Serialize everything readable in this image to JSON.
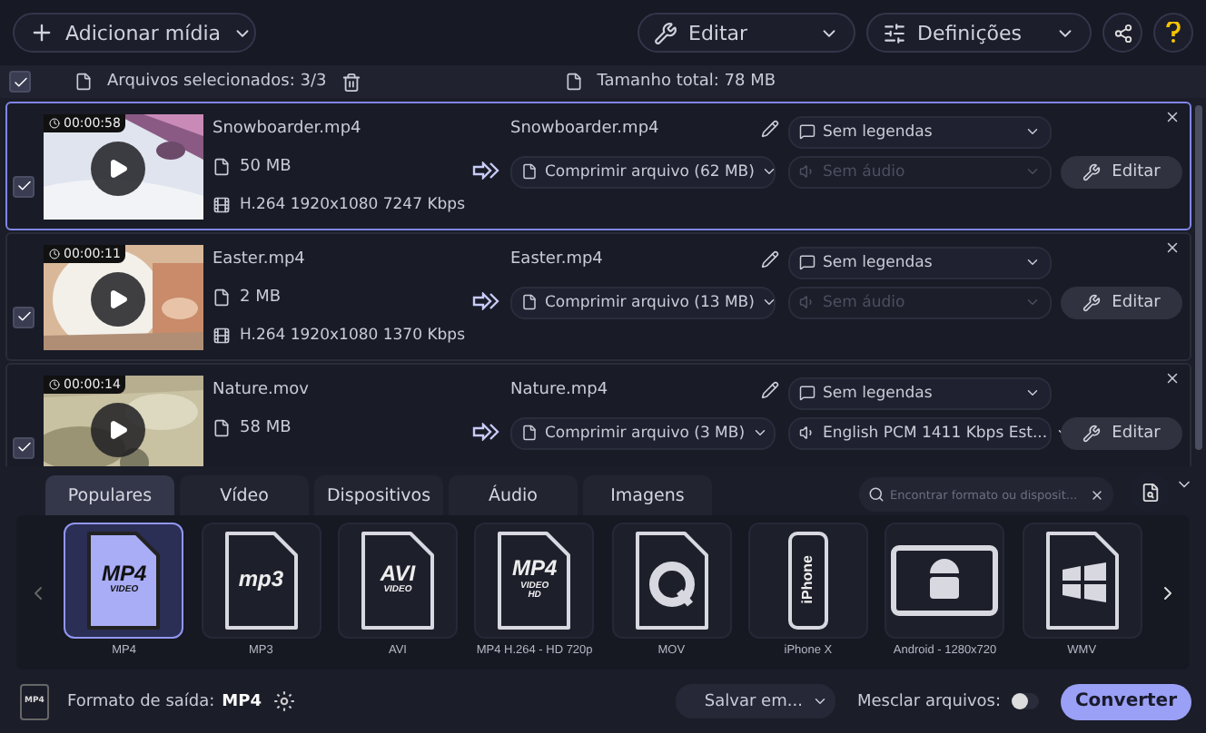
{
  "toolbar": {
    "add_button": "Adicionar mídia",
    "edit_menu": "Editar",
    "settings_menu": "Definições"
  },
  "selection": {
    "checked": true,
    "label": "Arquivos selecionados: 3/3",
    "total": "Tamanho total: 78 MB"
  },
  "files": [
    {
      "selected": true,
      "checked": true,
      "duration": "00:00:58",
      "name": "Snowboarder.mp4",
      "size": "50 MB",
      "codec": "H.264 1920x1080 7247 Kbps",
      "output_name": "Snowboarder.mp4",
      "compression": "Comprimir arquivo (62 MB)",
      "subtitles": "Sem legendas",
      "audio": "Sem áudio",
      "audio_disabled": true,
      "edit_button": "Editar"
    },
    {
      "selected": false,
      "checked": true,
      "duration": "00:00:11",
      "name": "Easter.mp4",
      "size": "2 MB",
      "codec": "H.264 1920x1080 1370 Kbps",
      "output_name": "Easter.mp4",
      "compression": "Comprimir arquivo (13 MB)",
      "subtitles": "Sem legendas",
      "audio": "Sem áudio",
      "audio_disabled": true,
      "edit_button": "Editar"
    },
    {
      "selected": false,
      "checked": true,
      "duration": "00:00:14",
      "name": "Nature.mov",
      "size": "58 MB",
      "output_name": "Nature.mp4",
      "compression": "Comprimir arquivo (3 MB)",
      "subtitles": "Sem legendas",
      "audio": "English PCM 1411 Kbps Est...",
      "audio_disabled": false,
      "edit_button": "Editar"
    }
  ],
  "format_tabs": [
    {
      "label": "Populares",
      "selected": true
    },
    {
      "label": "Vídeo",
      "selected": false
    },
    {
      "label": "Dispositivos",
      "selected": false
    },
    {
      "label": "Áudio",
      "selected": false
    },
    {
      "label": "Imagens",
      "selected": false
    }
  ],
  "search": {
    "placeholder": "Encontrar formato ou disposit..."
  },
  "formats": [
    {
      "label": "MP4",
      "selected": true,
      "kind": "doc",
      "icon_text": [
        "MP4",
        "VIDEO"
      ]
    },
    {
      "label": "MP3",
      "selected": false,
      "kind": "doc",
      "icon_text": [
        "mp3"
      ]
    },
    {
      "label": "AVI",
      "selected": false,
      "kind": "doc",
      "icon_text": [
        "AVI",
        "VIDEO"
      ]
    },
    {
      "label": "MP4 H.264 - HD 720p",
      "selected": false,
      "kind": "doc",
      "icon_text": [
        "MP4",
        "VIDEO",
        "HD"
      ]
    },
    {
      "label": "MOV",
      "selected": false,
      "kind": "quicktime"
    },
    {
      "label": "iPhone X",
      "selected": false,
      "kind": "phone",
      "icon_text": [
        "iPhone"
      ]
    },
    {
      "label": "Android - 1280x720",
      "selected": false,
      "kind": "tablet"
    },
    {
      "label": "WMV",
      "selected": false,
      "kind": "windows"
    }
  ],
  "output": {
    "badge": "MP4",
    "label": "Formato de saída:",
    "value": "MP4",
    "save_button": "Salvar em...",
    "merge_label": "Mesclar arquivos:",
    "merge_on": false,
    "convert_button": "Converter"
  }
}
